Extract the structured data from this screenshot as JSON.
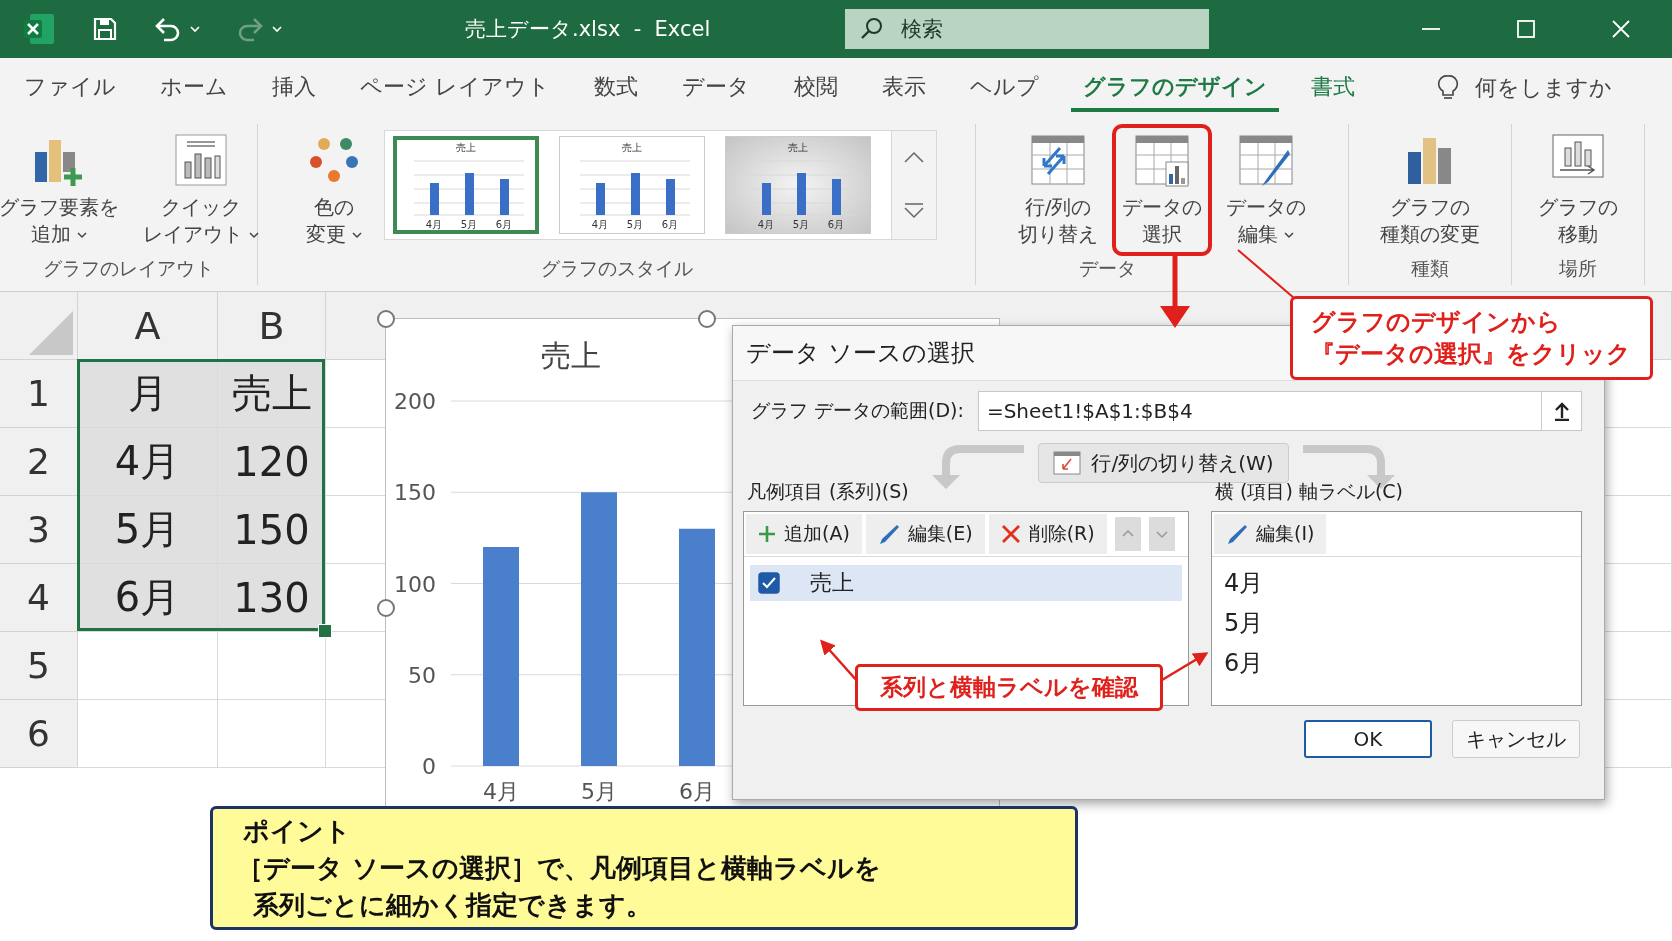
{
  "title_bar": {
    "title": "売上データ.xlsx  -  Excel",
    "search": {
      "placeholder": "検索"
    }
  },
  "tabs": [
    {
      "label": "ファイル",
      "selected": false,
      "contextual": false
    },
    {
      "label": "ホーム",
      "selected": false,
      "contextual": false
    },
    {
      "label": "挿入",
      "selected": false,
      "contextual": false
    },
    {
      "label": "ページ レイアウト",
      "selected": false,
      "contextual": false
    },
    {
      "label": "数式",
      "selected": false,
      "contextual": false
    },
    {
      "label": "データ",
      "selected": false,
      "contextual": false
    },
    {
      "label": "校閲",
      "selected": false,
      "contextual": false
    },
    {
      "label": "表示",
      "selected": false,
      "contextual": false
    },
    {
      "label": "ヘルプ",
      "selected": false,
      "contextual": false
    },
    {
      "label": "グラフのデザイン",
      "selected": true,
      "contextual": true
    },
    {
      "label": "書式",
      "selected": false,
      "contextual": true
    }
  ],
  "tell_me": "何をしますか",
  "ribbon": {
    "groups": [
      {
        "label": "グラフのレイアウト",
        "buttons": [
          {
            "kind": "add-element",
            "lines": [
              "グラフ要素を",
              "追加"
            ],
            "dropdown": true,
            "highlighted": false
          },
          {
            "kind": "quick-layout",
            "lines": [
              "クイック",
              "レイアウト"
            ],
            "dropdown": true,
            "highlighted": false
          }
        ]
      },
      {
        "label": "グラフのスタイル",
        "buttons": [
          {
            "kind": "colors",
            "lines": [
              "色の",
              "変更"
            ],
            "dropdown": true,
            "highlighted": false
          }
        ],
        "gallery": [
          {
            "kind": "white",
            "title": "売上",
            "categories": [
              "4月",
              "5月",
              "6月"
            ],
            "selected": true
          },
          {
            "kind": "white",
            "title": "売上",
            "categories": [
              "4月",
              "5月",
              "6月"
            ],
            "selected": false
          },
          {
            "kind": "shaded",
            "title": "売上",
            "categories": [
              "4月",
              "5月",
              "6月"
            ],
            "selected": false
          }
        ]
      },
      {
        "label": "データ",
        "buttons": [
          {
            "kind": "switch",
            "lines": [
              "行/列の",
              "切り替え"
            ],
            "dropdown": false,
            "highlighted": false
          },
          {
            "kind": "select-data",
            "lines": [
              "データの",
              "選択"
            ],
            "dropdown": false,
            "highlighted": true
          },
          {
            "kind": "edit-data",
            "lines": [
              "データの",
              "編集"
            ],
            "dropdown": true,
            "highlighted": false
          }
        ]
      },
      {
        "label": "種類",
        "buttons": [
          {
            "kind": "change-type",
            "lines": [
              "グラフの",
              "種類の変更"
            ],
            "dropdown": false,
            "highlighted": false
          }
        ]
      },
      {
        "label": "場所",
        "buttons": [
          {
            "kind": "move-chart",
            "lines": [
              "グラフの",
              "移動"
            ],
            "dropdown": false,
            "highlighted": false
          }
        ]
      }
    ]
  },
  "sheet": {
    "columns": [
      "A",
      "B"
    ],
    "rows": [
      {
        "number": "1",
        "cells": [
          "月",
          "売上"
        ],
        "selected": true
      },
      {
        "number": "2",
        "cells": [
          "4月",
          "120"
        ],
        "selected": true
      },
      {
        "number": "3",
        "cells": [
          "5月",
          "150"
        ],
        "selected": true
      },
      {
        "number": "4",
        "cells": [
          "6月",
          "130"
        ],
        "selected": true
      },
      {
        "number": "5",
        "selected": false
      },
      {
        "number": "6",
        "selected": false
      }
    ]
  },
  "chart": {
    "chart_data": {
      "type": "bar",
      "title": "売上",
      "categories": [
        "4月",
        "5月",
        "6月"
      ],
      "values": [
        120,
        150,
        130
      ],
      "ylim": [
        0,
        200
      ],
      "yticks": [
        0,
        50,
        100,
        150,
        200
      ],
      "grid": true
    }
  },
  "dialog": {
    "title": "データ ソースの選択",
    "range_label": "グラフ データの範囲(D):",
    "range_value": "=Sheet1!$A$1:$B$4",
    "switch_button": "行/列の切り替え(W)",
    "legend_label": "凡例項目 (系列)(S)",
    "legend_buttons": [
      {
        "kind": "add",
        "label": "追加(A)"
      },
      {
        "kind": "edit",
        "label": "編集(E)"
      },
      {
        "kind": "delete",
        "label": "削除(R)"
      }
    ],
    "series": [
      {
        "name": "売上",
        "checked": true,
        "selected": true
      }
    ],
    "axis_label": "横 (項目) 軸ラベル(C)",
    "axis_edit": "編集(I)",
    "categories": [
      "4月",
      "5月",
      "6月"
    ],
    "ok": "OK",
    "cancel": "キャンセル"
  },
  "ribbon_callout": {
    "lines": [
      "グラフのデザインから",
      "『データの選択』をクリック"
    ]
  },
  "list_callout": {
    "text": "系列と横軸ラベルを確認"
  },
  "note": {
    "heading": "ポイント",
    "lines": [
      "［データ ソースの選択］で、凡例項目と横軸ラベルを",
      "系列ごとに細かく指定できます。"
    ]
  }
}
